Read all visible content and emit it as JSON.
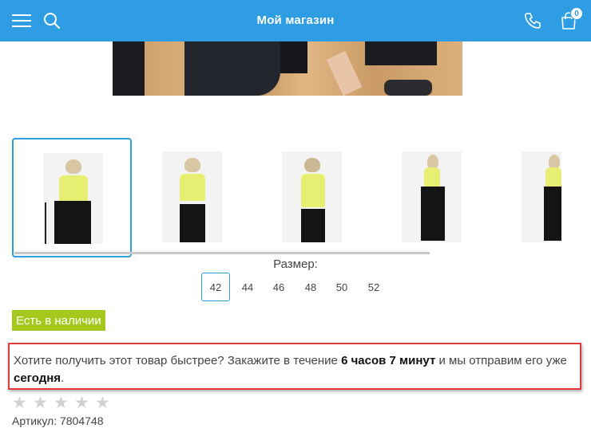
{
  "header": {
    "title": "Мой магазин",
    "cart_count": "0",
    "icons": [
      "menu-icon",
      "search-icon",
      "phone-icon",
      "cart-icon"
    ],
    "color": "#2e9de4"
  },
  "gallery": {
    "thumbnails": [
      "thumb-1",
      "thumb-2",
      "thumb-3",
      "thumb-4",
      "thumb-5"
    ]
  },
  "sizes": {
    "label": "Размер:",
    "options": [
      "42",
      "44",
      "46",
      "48",
      "50",
      "52"
    ],
    "selected": "42"
  },
  "stock": {
    "label": "Есть в наличии",
    "color": "#a5c81d"
  },
  "notice": {
    "text_before": "Хотите получить этот товар быстрее? Закажите в течение ",
    "time": "6 часов 7 минут",
    "text_middle": " и мы отправим его уже ",
    "day": "сегодня",
    "text_end": "."
  },
  "rating": {
    "stars": [
      "★",
      "★",
      "★",
      "★",
      "★"
    ]
  },
  "sku": {
    "label": "Артикул: 7804748"
  }
}
